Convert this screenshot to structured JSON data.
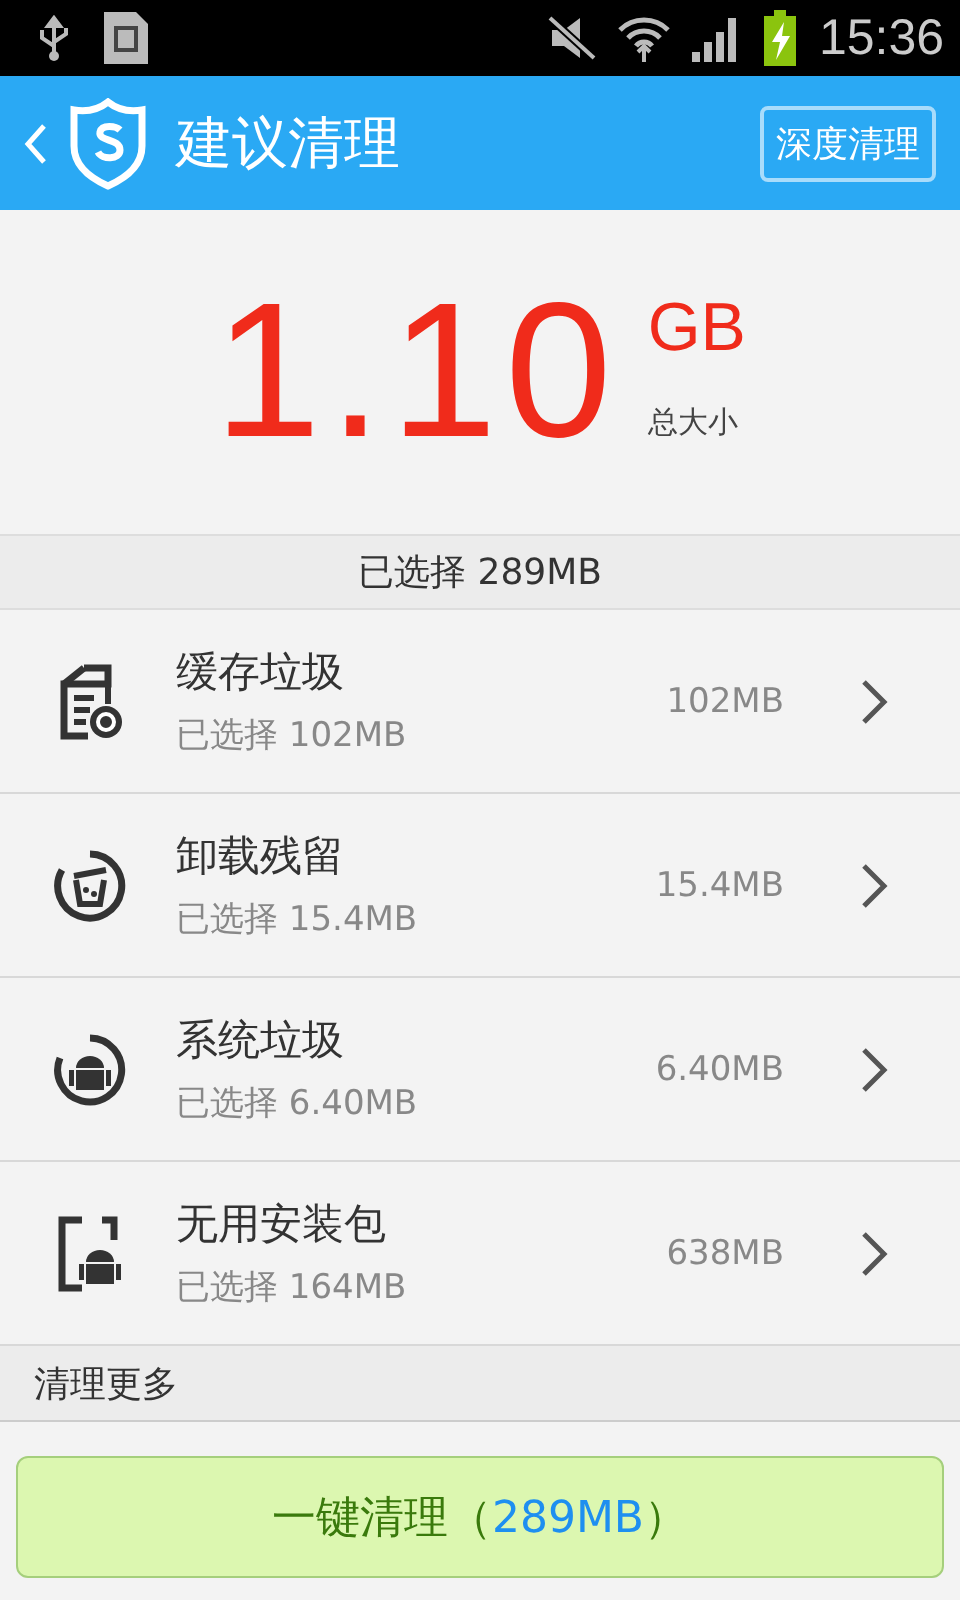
{
  "status_bar": {
    "time": "15:36"
  },
  "header": {
    "title": "建议清理",
    "action": "深度清理"
  },
  "total": {
    "value": "1.10",
    "unit": "GB",
    "caption": "总大小"
  },
  "selected_summary": "已选择 289MB",
  "items": [
    {
      "kind": "file",
      "name": "缓存垃圾",
      "detail": "已选择 102MB",
      "size": "102MB"
    },
    {
      "kind": "trash",
      "name": "卸载残留",
      "detail": "已选择 15.4MB",
      "size": "15.4MB"
    },
    {
      "kind": "system",
      "name": "系统垃圾",
      "detail": "已选择 6.40MB",
      "size": "6.40MB"
    },
    {
      "kind": "apk",
      "name": "无用安装包",
      "detail": "已选择 164MB",
      "size": "638MB"
    }
  ],
  "more": "清理更多",
  "clean_button": {
    "label": "一键清理（",
    "amount": "289MB",
    "suffix": "）"
  }
}
